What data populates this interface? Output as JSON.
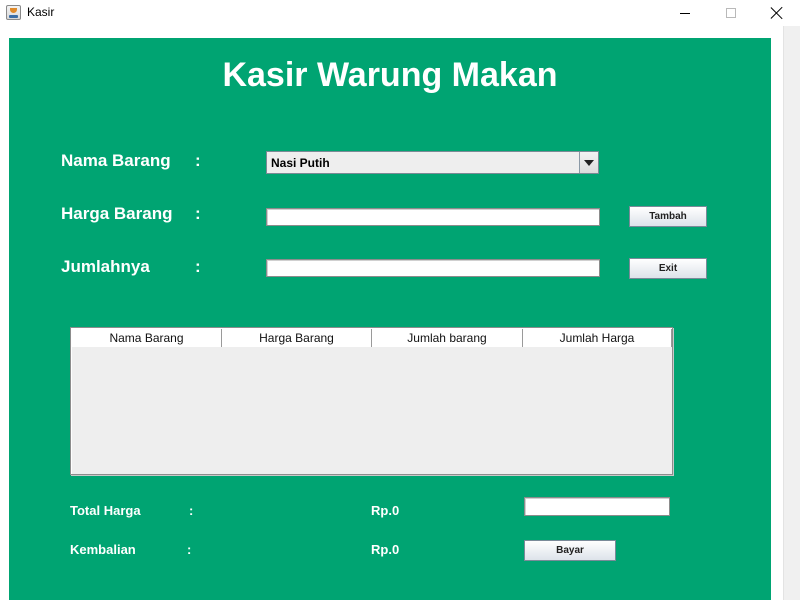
{
  "window": {
    "title": "Kasir"
  },
  "heading": "Kasir Warung Makan",
  "form": {
    "nama_label": "Nama Barang",
    "harga_label": "Harga Barang",
    "jumlah_label": "Jumlahnya",
    "colon": ":",
    "nama_selected": "Nasi Putih",
    "harga_value": "",
    "jumlah_value": "",
    "tambah_label": "Tambah",
    "exit_label": "Exit"
  },
  "table": {
    "columns": [
      "Nama Barang",
      "Harga Barang",
      "Jumlah barang",
      "Jumlah Harga"
    ],
    "rows": []
  },
  "summary": {
    "total_label": "Total Harga",
    "kembalian_label": "Kembalian",
    "colon": ":",
    "total_value": "Rp.0",
    "kembalian_value": "Rp.0",
    "bayar_input_value": "",
    "bayar_label": "Bayar"
  },
  "colors": {
    "panel": "#00a472",
    "text": "#ffffff"
  },
  "icons": {
    "app": "java-cup-icon",
    "minimize": "minimize-icon",
    "maximize": "maximize-icon",
    "close": "close-icon"
  }
}
